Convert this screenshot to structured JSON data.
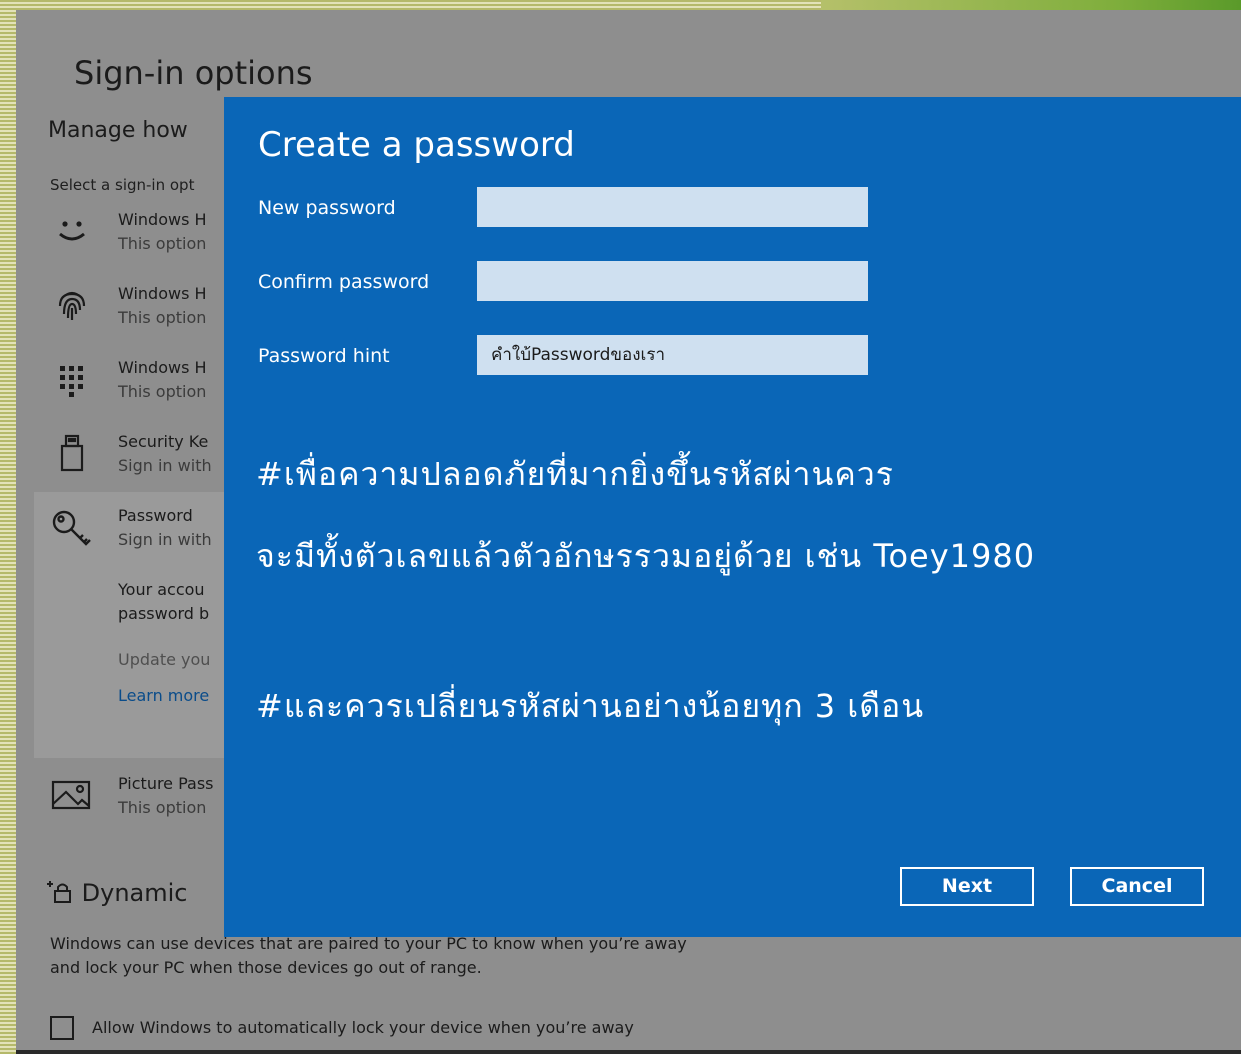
{
  "settings": {
    "title": "Sign-in options",
    "subtitle": "Manage how",
    "select_label": "Select a sign-in opt",
    "options": [
      {
        "icon": "face-icon",
        "name": "Windows H",
        "desc": "This option"
      },
      {
        "icon": "fingerprint-icon",
        "name": "Windows H",
        "desc": "This option"
      },
      {
        "icon": "keypad-icon",
        "name": "Windows H",
        "desc": "This option"
      },
      {
        "icon": "security-key-icon",
        "name": "Security Ke",
        "desc": "Sign in with"
      },
      {
        "icon": "key-icon",
        "name": "Password",
        "desc": "Sign in with"
      }
    ],
    "password_panel": {
      "line1": "Your accou",
      "line2": "password b",
      "update": "Update you",
      "learn_more": "Learn more"
    },
    "picture_password": {
      "icon": "picture-icon",
      "name": "Picture Pass",
      "desc": "This option"
    },
    "dynamic_lock": {
      "icon": "dynamic-lock-icon",
      "title": "Dynamic",
      "description": "Windows can use devices that are paired to your PC to know when you’re away and lock your PC when those devices go out of range.",
      "checkbox_label": "Allow Windows to automatically lock your device when you’re away",
      "checked": false
    }
  },
  "dialog": {
    "title": "Create a password",
    "new_password_label": "New password",
    "new_password_value": "",
    "confirm_password_label": "Confirm password",
    "confirm_password_value": "",
    "hint_label": "Password hint",
    "hint_value": "คำใบ้Passwordของเรา",
    "note_line1": "#เพื่อความปลอดภัยที่มากยิ่งขึ้นรหัสผ่านควร",
    "note_line2": "จะมีทั้งตัวเลขแล้วตัวอักษรรวมอยู่ด้วย เช่น Toey1980",
    "note_line3": "#และควรเปลี่ยนรหัสผ่านอย่างน้อยทุก 3 เดือน",
    "next_label": "Next",
    "cancel_label": "Cancel"
  },
  "colors": {
    "dialog_bg": "#0a66b7",
    "field_bg": "#cfe0f0",
    "settings_bg": "#8e8e8e"
  }
}
